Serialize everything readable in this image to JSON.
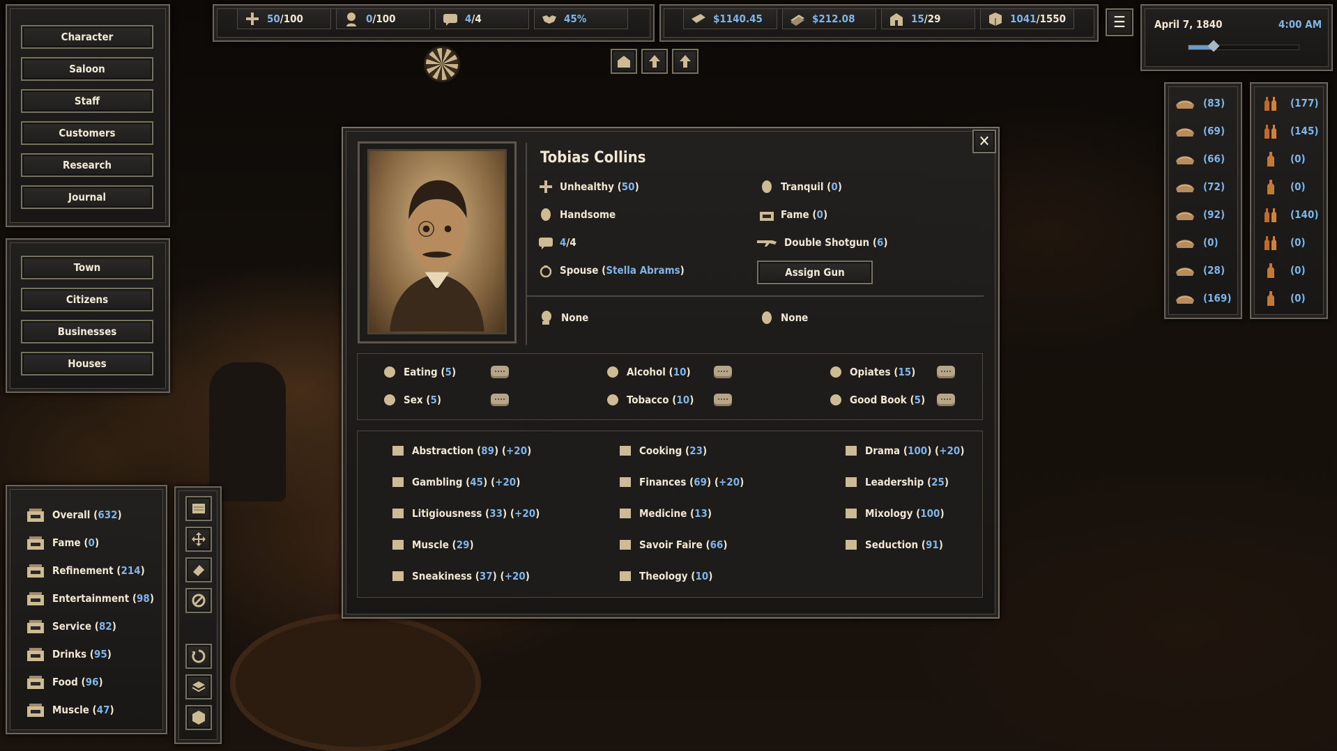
{
  "left_menu": {
    "top_buttons": [
      "Character",
      "Saloon",
      "Staff",
      "Customers",
      "Research",
      "Journal"
    ],
    "bottom_buttons": [
      "Town",
      "Citizens",
      "Businesses",
      "Houses"
    ]
  },
  "top_stats": {
    "health": {
      "value": "50",
      "max": "/100"
    },
    "happiness": {
      "value": "0",
      "max": "/100"
    },
    "talk": {
      "value": "4",
      "max": "/4"
    },
    "reputation": {
      "value": "45%"
    }
  },
  "money": {
    "cash": "$1140.45",
    "income": "$212.08",
    "rooms": {
      "value": "15",
      "max": "/29"
    },
    "storage": {
      "value": "1041",
      "max": "/1550"
    }
  },
  "clock": {
    "date": "April 7, 1840",
    "time": "4:00 AM"
  },
  "inventory_left": [
    {
      "icon": "food-icon",
      "count": "(83)"
    },
    {
      "icon": "food-icon",
      "count": "(69)"
    },
    {
      "icon": "meat-icon",
      "count": "(66)"
    },
    {
      "icon": "meat-icon",
      "count": "(72)"
    },
    {
      "icon": "food-icon",
      "count": "(92)"
    },
    {
      "icon": "cigar-icon",
      "count": "(0)"
    },
    {
      "icon": "barrel-icon",
      "count": "(28)"
    },
    {
      "icon": "box-icon",
      "count": "(169)"
    }
  ],
  "inventory_right": [
    {
      "icon": "bottles-icon",
      "count": "(177)"
    },
    {
      "icon": "bottles-icon",
      "count": "(145)"
    },
    {
      "icon": "bottle-icon",
      "count": "(0)"
    },
    {
      "icon": "bottle-icon",
      "count": "(0)"
    },
    {
      "icon": "bottles-icon",
      "count": "(140)"
    },
    {
      "icon": "bottles-icon",
      "count": "(0)"
    },
    {
      "icon": "bottle-icon",
      "count": "(0)"
    },
    {
      "icon": "bottle-icon",
      "count": "(0)"
    }
  ],
  "character": {
    "name": "Tobias Collins",
    "health": {
      "label": "Unhealthy",
      "value": "50"
    },
    "looks": {
      "label": "Handsome"
    },
    "talk": {
      "value": "4",
      "max": "/4"
    },
    "spouse": {
      "label": "Spouse",
      "name": "Stella Abrams"
    },
    "mood": {
      "label": "Tranquil",
      "value": "0"
    },
    "fame": {
      "label": "Fame",
      "value": "0"
    },
    "gun": {
      "label": "Double Shotgun",
      "value": "6"
    },
    "assign_gun": "Assign Gun",
    "slot1": "None",
    "slot2": "None",
    "needs": [
      {
        "label": "Eating",
        "value": "5"
      },
      {
        "label": "Alcohol",
        "value": "10"
      },
      {
        "label": "Opiates",
        "value": "15"
      },
      {
        "label": "Sex",
        "value": "5"
      },
      {
        "label": "Tobacco",
        "value": "10"
      },
      {
        "label": "Good Book",
        "value": "5"
      }
    ],
    "skills": [
      {
        "label": "Abstraction",
        "value": "89",
        "bonus": "+20"
      },
      {
        "label": "Cooking",
        "value": "23",
        "bonus": ""
      },
      {
        "label": "Drama",
        "value": "100",
        "bonus": "+20"
      },
      {
        "label": "Gambling",
        "value": "45",
        "bonus": "+20"
      },
      {
        "label": "Finances",
        "value": "69",
        "bonus": "+20"
      },
      {
        "label": "Leadership",
        "value": "25",
        "bonus": ""
      },
      {
        "label": "Litigiousness",
        "value": "33",
        "bonus": "+20"
      },
      {
        "label": "Medicine",
        "value": "13",
        "bonus": ""
      },
      {
        "label": "Mixology",
        "value": "100",
        "bonus": ""
      },
      {
        "label": "Muscle",
        "value": "29",
        "bonus": ""
      },
      {
        "label": "Savoir Faire",
        "value": "66",
        "bonus": ""
      },
      {
        "label": "Seduction",
        "value": "91",
        "bonus": ""
      },
      {
        "label": "Sneakiness",
        "value": "37",
        "bonus": "+20"
      },
      {
        "label": "Theology",
        "value": "10",
        "bonus": ""
      }
    ]
  },
  "saloon_stats": [
    {
      "label": "Overall",
      "value": "632"
    },
    {
      "label": "Fame",
      "value": "0"
    },
    {
      "label": "Refinement",
      "value": "214"
    },
    {
      "label": "Entertainment",
      "value": "98"
    },
    {
      "label": "Service",
      "value": "82"
    },
    {
      "label": "Drinks",
      "value": "95"
    },
    {
      "label": "Food",
      "value": "96"
    },
    {
      "label": "Muscle",
      "value": "47"
    }
  ],
  "colors": {
    "value_blue": "#7fb4e8",
    "panel": "#222120",
    "border": "#6b655d",
    "text": "#f1e7d3"
  }
}
